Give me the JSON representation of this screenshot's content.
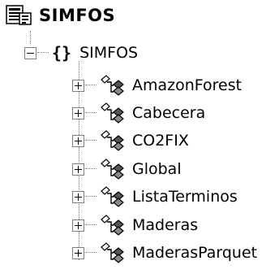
{
  "tree": {
    "root": {
      "label": "SIMFOS",
      "icon": "assembly-icon"
    },
    "namespace": {
      "label": "SIMFOS",
      "icon": "namespace-braces-icon",
      "expanded": true
    },
    "classes": [
      {
        "label": "AmazonForest",
        "icon": "class-icon",
        "expanded": false
      },
      {
        "label": "Cabecera",
        "icon": "class-icon",
        "expanded": false
      },
      {
        "label": "CO2FIX",
        "icon": "class-icon",
        "expanded": false
      },
      {
        "label": "Global",
        "icon": "class-icon",
        "expanded": false
      },
      {
        "label": "ListaTerminos",
        "icon": "class-icon",
        "expanded": false
      },
      {
        "label": "Maderas",
        "icon": "class-icon",
        "expanded": false
      },
      {
        "label": "MaderasParquet",
        "icon": "class-icon",
        "expanded": false
      }
    ]
  }
}
